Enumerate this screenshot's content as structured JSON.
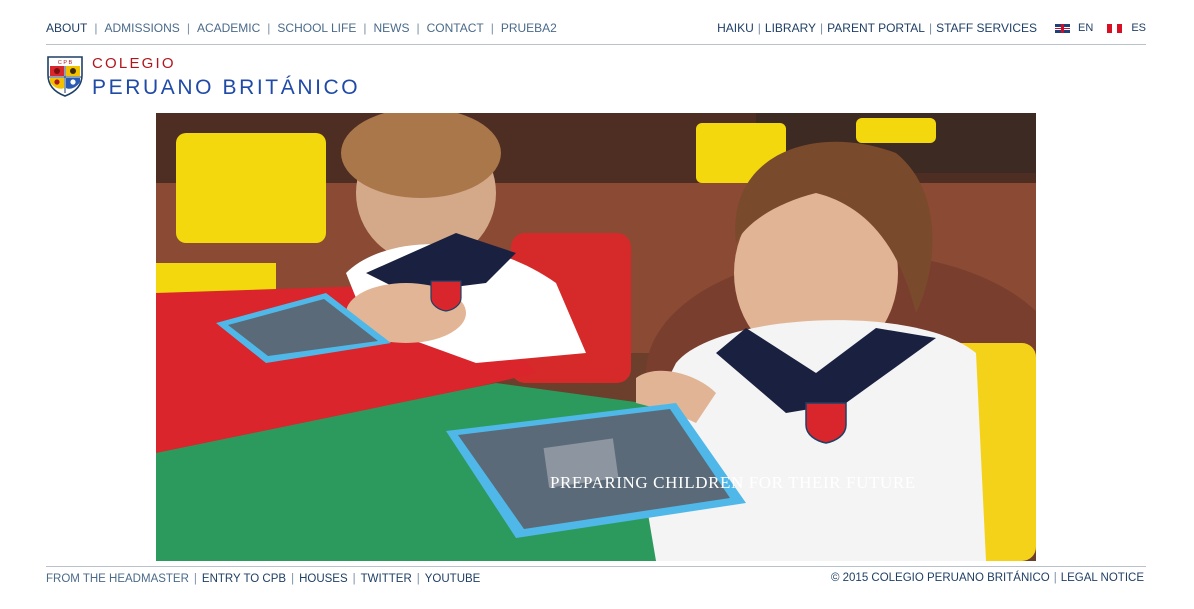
{
  "topnav": {
    "left": [
      "ABOUT",
      "ADMISSIONS",
      "ACADEMIC",
      "SCHOOL LIFE",
      "NEWS",
      "CONTACT",
      "PRUEBA2"
    ],
    "right": [
      "HAIKU",
      "LIBRARY",
      "PARENT PORTAL",
      "STAFF SERVICES"
    ],
    "lang_en": "EN",
    "lang_es": "ES"
  },
  "logo": {
    "line1": "COLEGIO",
    "line2": "PERUANO BRITÁNICO",
    "crest_letters": "C P B"
  },
  "hero": {
    "caption": "PREPARING CHILDREN FOR THEIR FUTURE"
  },
  "footer": {
    "left": [
      "FROM THE HEADMASTER",
      "ENTRY TO CPB",
      "HOUSES",
      "TWITTER",
      "YOUTUBE"
    ],
    "copyright": "© 2015 COLEGIO PERUANO BRITÁNICO",
    "legal": "LEGAL NOTICE"
  },
  "colors": {
    "nav_text": "#1f3f66",
    "logo_red": "#b0161d",
    "logo_blue": "#1f4aa8",
    "rule": "#b9c1cb"
  }
}
